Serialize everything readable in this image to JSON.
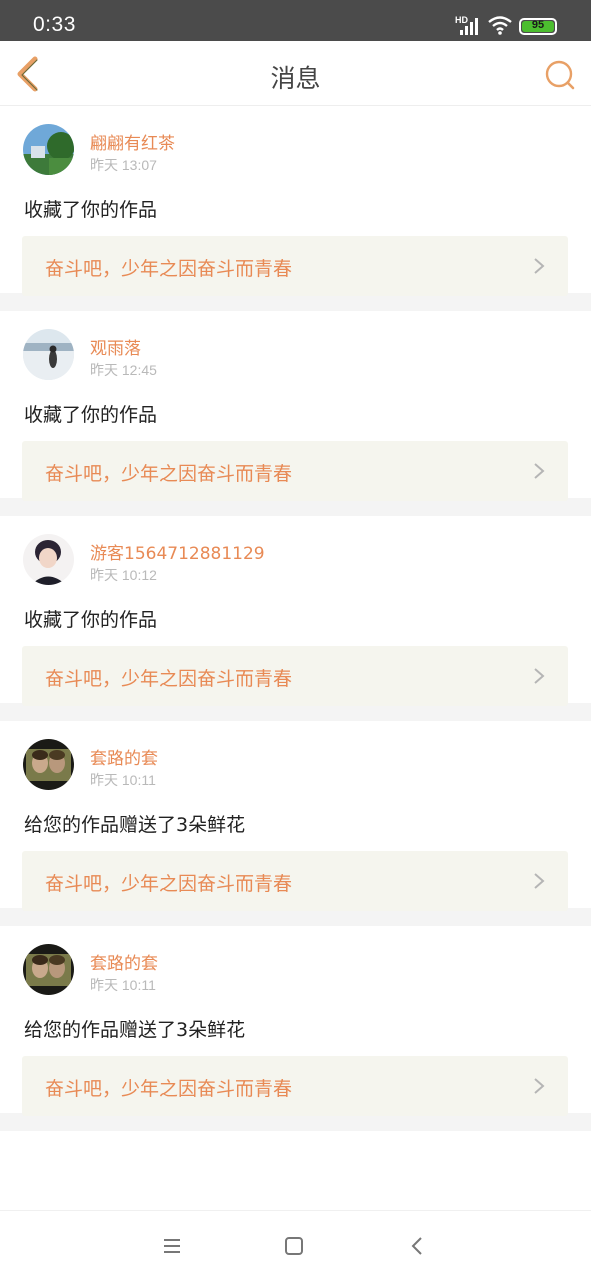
{
  "status_bar": {
    "time": "0:33",
    "network": "HD",
    "battery": "95",
    "icons": [
      "signal-icon",
      "wifi-icon",
      "battery-icon"
    ]
  },
  "header": {
    "title": "消息",
    "back_icon": "chevron-left-icon",
    "search_icon": "search-icon",
    "accent_color": "#e8a066"
  },
  "messages": [
    {
      "name": "翩翩有红茶",
      "time": "昨天 13:07",
      "action": "收藏了你的作品",
      "work_title": "奋斗吧，少年之因奋斗而青春"
    },
    {
      "name": "观雨落",
      "time": "昨天 12:45",
      "action": "收藏了你的作品",
      "work_title": "奋斗吧，少年之因奋斗而青春"
    },
    {
      "name": "游客1564712881129",
      "time": "昨天 10:12",
      "action": "收藏了你的作品",
      "work_title": "奋斗吧，少年之因奋斗而青春"
    },
    {
      "name": "套路的套",
      "time": "昨天 10:11",
      "action": "给您的作品赠送了3朵鲜花",
      "work_title": "奋斗吧，少年之因奋斗而青春"
    },
    {
      "name": "套路的套",
      "time": "昨天 10:11",
      "action": "给您的作品赠送了3朵鲜花",
      "work_title": "奋斗吧，少年之因奋斗而青春"
    }
  ],
  "colors": {
    "name": "#e88a55",
    "work_bg": "#f5f5ee",
    "separator": "#f4f4f4",
    "status_bar": "#4b4b4b"
  },
  "system_nav": [
    "menu-icon",
    "home-icon",
    "back-icon"
  ]
}
